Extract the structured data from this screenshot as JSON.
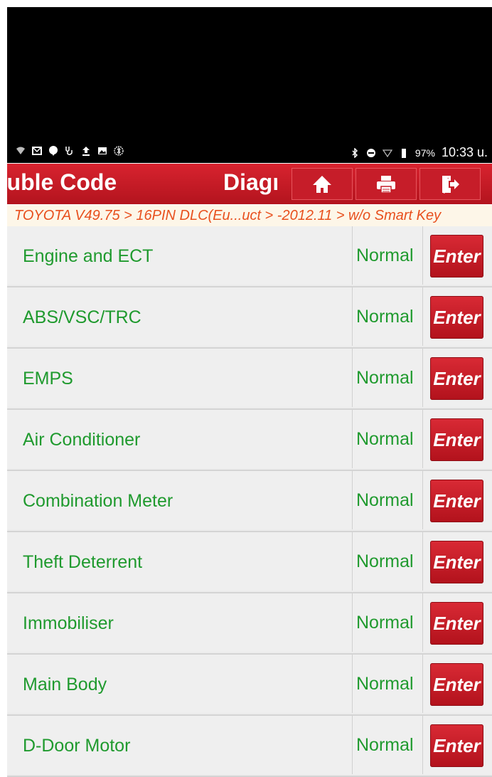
{
  "status_bar": {
    "battery": "97%",
    "time": "10:33 u."
  },
  "header": {
    "title_left": "ouble Code",
    "title_right": "Diagr",
    "home_icon": "home-icon",
    "print_icon": "printer-icon",
    "exit_icon": "exit-icon"
  },
  "breadcrumb": "TOYOTA V49.75 > 16PIN DLC(Eu...uct > -2012.11 > w/o Smart Key",
  "systems": [
    {
      "name": "Engine and ECT",
      "status": "Normal",
      "action": "Enter"
    },
    {
      "name": "ABS/VSC/TRC",
      "status": "Normal",
      "action": "Enter"
    },
    {
      "name": "EMPS",
      "status": "Normal",
      "action": "Enter"
    },
    {
      "name": "Air Conditioner",
      "status": "Normal",
      "action": "Enter"
    },
    {
      "name": "Combination Meter",
      "status": "Normal",
      "action": "Enter"
    },
    {
      "name": "Theft Deterrent",
      "status": "Normal",
      "action": "Enter"
    },
    {
      "name": "Immobiliser",
      "status": "Normal",
      "action": "Enter"
    },
    {
      "name": "Main Body",
      "status": "Normal",
      "action": "Enter"
    },
    {
      "name": "D-Door Motor",
      "status": "Normal",
      "action": "Enter"
    }
  ],
  "colors": {
    "accent": "#c61d29",
    "status_green": "#1f9a2e",
    "breadcrumb": "#e8501e"
  }
}
